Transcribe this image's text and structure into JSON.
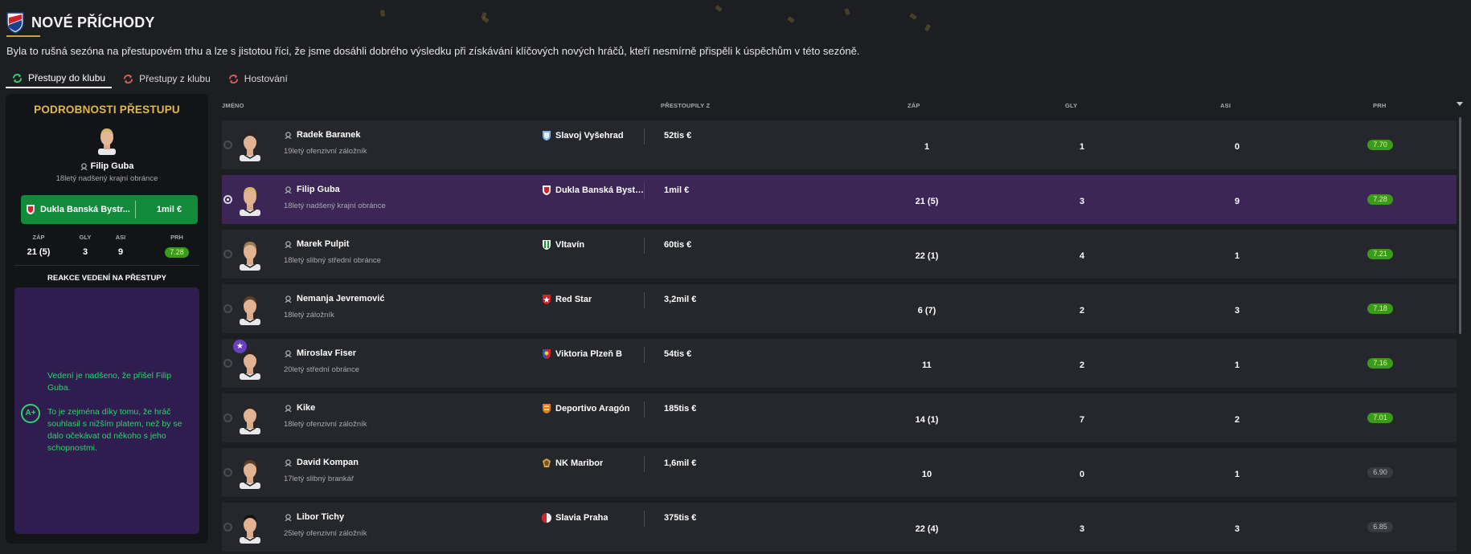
{
  "header": {
    "title": "NOVÉ PŘÍCHODY",
    "intro": "Byla to rušná sezóna na přestupovém trhu a lze s jistotou říci, že jsme dosáhli dobrého výsledku při získávání klíčových nových hráčů, kteří nesmírně přispěli k úspěchům v této sezóně."
  },
  "tabs": [
    {
      "label": "Přestupy do klubu",
      "active": true
    },
    {
      "label": "Přestupy z klubu",
      "active": false
    },
    {
      "label": "Hostování",
      "active": false
    }
  ],
  "detail": {
    "title": "PODROBNOSTI PŘESTUPU",
    "player_name": "Filip Guba",
    "player_desc": "18letý nadšený krajní obránce",
    "club": "Dukla Banská Bystr...",
    "fee": "1mil €",
    "stats": [
      {
        "label": "ZÁP",
        "value": "21 (5)"
      },
      {
        "label": "GLY",
        "value": "3"
      },
      {
        "label": "ASI",
        "value": "9"
      },
      {
        "label": "PRH",
        "value": "7.28"
      }
    ],
    "reaction_title": "REAKCE VEDENÍ NA PŘESTUPY",
    "grade": "A+",
    "reaction_line1": "Vedení je nadšeno, že přišel Filip Guba.",
    "reaction_line2": "To je zejména díky tomu, že hráč souhlasil s nižším platem, než by se dalo očekávat od někoho s jeho schopnostmi."
  },
  "columns": {
    "name": "JMÉNO",
    "from": "PŘESTOUPILY Z",
    "apps": "ZÁP",
    "goals": "GLY",
    "assists": "ASI",
    "rating": "PRH"
  },
  "rows": [
    {
      "name": "Radek Baranek",
      "desc": "19letý ofenzivní záložník",
      "club": "Slavoj Vyšehrad",
      "club_icon": "shield-blue",
      "fee": "52tis €",
      "apps": "1",
      "goals": "1",
      "assists": "0",
      "rating": "7.70",
      "rating_style": "green",
      "hair": "dark",
      "selected": false,
      "star": false
    },
    {
      "name": "Filip Guba",
      "desc": "18letý nadšený krajní obránce",
      "club": "Dukla Banská Bystr...",
      "club_icon": "shield-red",
      "fee": "1mil €",
      "apps": "21 (5)",
      "goals": "3",
      "assists": "9",
      "rating": "7.28",
      "rating_style": "green",
      "hair": "blond",
      "selected": true,
      "star": false
    },
    {
      "name": "Marek Pulpit",
      "desc": "18letý slibný střední obránce",
      "club": "Vltavín",
      "club_icon": "shield-green",
      "fee": "60tis €",
      "apps": "22 (1)",
      "goals": "4",
      "assists": "1",
      "rating": "7.21",
      "rating_style": "green",
      "hair": "light",
      "selected": false,
      "star": false
    },
    {
      "name": "Nemanja Jevremović",
      "desc": "18letý záložník",
      "club": "Red Star",
      "club_icon": "shield-redstar",
      "fee": "3,2mil €",
      "apps": "6 (7)",
      "goals": "2",
      "assists": "3",
      "rating": "7.18",
      "rating_style": "green",
      "hair": "brown",
      "selected": false,
      "star": false
    },
    {
      "name": "Miroslav Fiser",
      "desc": "20letý střední obránce",
      "club": "Viktoria Plzeň B",
      "club_icon": "shield-viktoria",
      "fee": "54tis €",
      "apps": "11",
      "goals": "2",
      "assists": "1",
      "rating": "7.16",
      "rating_style": "green",
      "hair": "dark",
      "selected": false,
      "star": true
    },
    {
      "name": "Kike",
      "desc": "18letý ofenzivní záložník",
      "club": "Deportivo Aragón",
      "club_icon": "shield-orange",
      "fee": "185tis €",
      "apps": "14 (1)",
      "goals": "7",
      "assists": "2",
      "rating": "7.01",
      "rating_style": "green",
      "hair": "dark",
      "selected": false,
      "star": false
    },
    {
      "name": "David Kompan",
      "desc": "17letý slibný brankář",
      "club": "NK Maribor",
      "club_icon": "shield-maribor",
      "fee": "1,6mil €",
      "apps": "10",
      "goals": "0",
      "assists": "1",
      "rating": "6.90",
      "rating_style": "grey",
      "hair": "brown",
      "selected": false,
      "star": false
    },
    {
      "name": "Libor Tichy",
      "desc": "25letý ofenzivní záložník",
      "club": "Slavia Praha",
      "club_icon": "circle-slavia",
      "fee": "375tis €",
      "apps": "22 (4)",
      "goals": "3",
      "assists": "3",
      "rating": "6.85",
      "rating_style": "grey",
      "hair": "black",
      "selected": false,
      "star": false
    }
  ],
  "colors": {
    "accent_gold": "#e0b84a",
    "positive_green": "#2fd36a",
    "selected_row": "#3b2656",
    "transfer_bar": "#128a3a"
  }
}
